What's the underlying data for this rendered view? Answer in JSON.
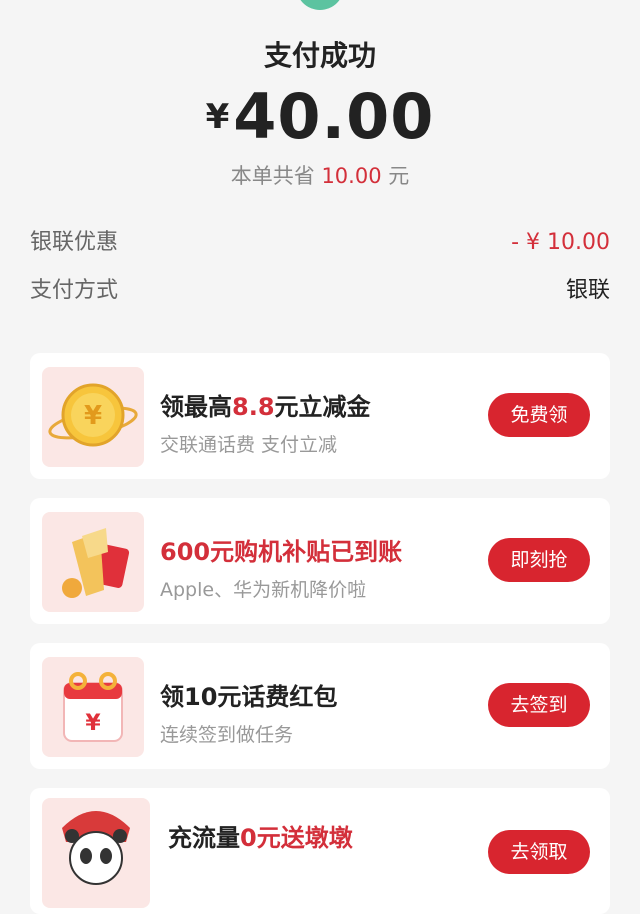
{
  "status": {
    "title": "支付成功",
    "currency": "¥",
    "amount": "40.00",
    "saved_prefix": "本单共省",
    "saved_amount": "10.00",
    "saved_suffix": "元"
  },
  "details": [
    {
      "label": "银联优惠",
      "value": "- ¥ 10.00"
    },
    {
      "label": "支付方式",
      "value": "银联"
    }
  ],
  "offers": [
    {
      "title_pre": "领最高",
      "title_hl": "8.8",
      "title_post": "元立减金",
      "subtitle": "交联通话费 支付立减",
      "button": "免费领",
      "icon": "gold-coin-icon"
    },
    {
      "title": "600元购机补贴已到账",
      "subtitle": "Apple、华为新机降价啦",
      "button": "即刻抢",
      "icon": "red-envelope-icon"
    },
    {
      "title": "领10元话费红包",
      "subtitle": "连续签到做任务",
      "button": "去签到",
      "icon": "calendar-icon"
    },
    {
      "title_pre": "充流量",
      "title_hl": "0元送墩墩",
      "button": "去领取",
      "icon": "panda-mascot-icon"
    }
  ],
  "colors": {
    "accent": "#d8252f",
    "price_red": "#d32f3a",
    "success_green": "#5cc3a0"
  }
}
